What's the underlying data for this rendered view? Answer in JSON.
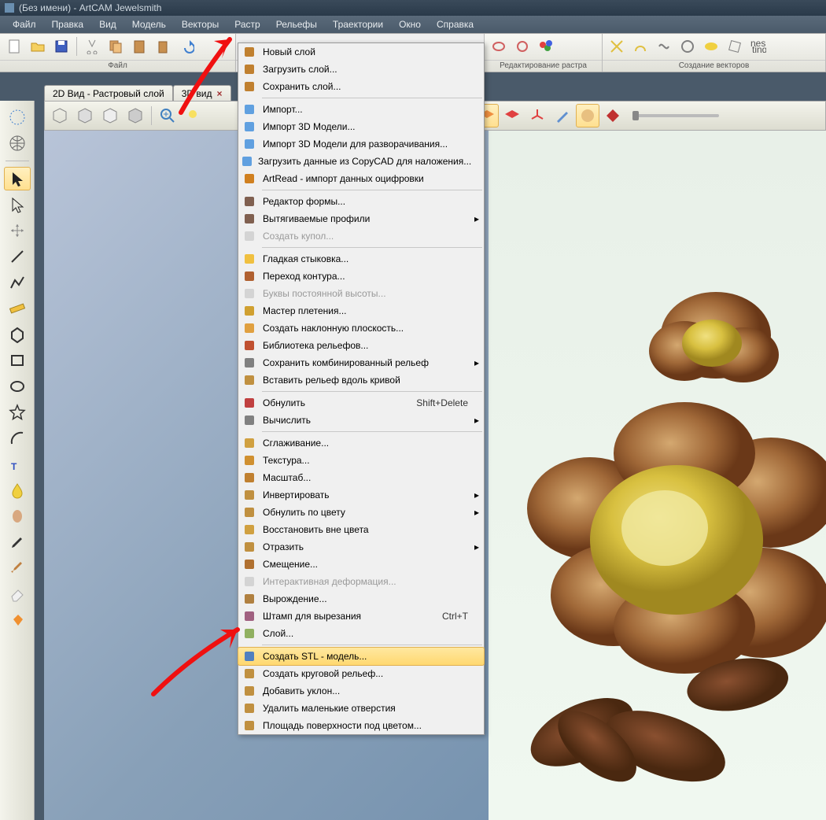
{
  "title": "(Без имени) - ArtCAM Jewelsmith",
  "menu": [
    "Файл",
    "Правка",
    "Вид",
    "Модель",
    "Векторы",
    "Растр",
    "Рельефы",
    "Траектории",
    "Окно",
    "Справка"
  ],
  "top_groups": {
    "file": "Файл",
    "raster": "Редактирование растра",
    "vector": "Создание векторов"
  },
  "tabs": {
    "t2d": "2D Вид - Растровый слой",
    "t3d": "3D вид"
  },
  "dropdown": [
    {
      "t": "Новый слой"
    },
    {
      "t": "Загрузить слой..."
    },
    {
      "t": "Сохранить слой..."
    },
    {
      "sep": true
    },
    {
      "t": "Импорт..."
    },
    {
      "t": "Импорт 3D Модели..."
    },
    {
      "t": "Импорт 3D Модели для разворачивания..."
    },
    {
      "t": "Загрузить данные из CopyCAD для наложения..."
    },
    {
      "t": "ArtRead - импорт данных оцифровки"
    },
    {
      "sep": true
    },
    {
      "t": "Редактор формы..."
    },
    {
      "t": "Вытягиваемые профили",
      "sub": true
    },
    {
      "t": "Создать купол...",
      "disabled": true
    },
    {
      "sep": true
    },
    {
      "t": "Гладкая стыковка..."
    },
    {
      "t": "Переход контура..."
    },
    {
      "t": "Буквы постоянной высоты...",
      "disabled": true
    },
    {
      "t": "Мастер плетения..."
    },
    {
      "t": "Создать наклонную плоскость..."
    },
    {
      "t": "Библиотека рельефов..."
    },
    {
      "t": "Сохранить комбинированный рельеф",
      "sub": true
    },
    {
      "t": "Вставить рельеф вдоль кривой"
    },
    {
      "sep": true
    },
    {
      "t": "Обнулить",
      "key": "Shift+Delete"
    },
    {
      "t": "Вычислить",
      "sub": true
    },
    {
      "sep": true
    },
    {
      "t": "Сглаживание..."
    },
    {
      "t": "Текстура..."
    },
    {
      "t": "Масштаб..."
    },
    {
      "t": "Инвертировать",
      "sub": true
    },
    {
      "t": "Обнулить по цвету",
      "sub": true
    },
    {
      "t": "Восстановить вне цвета"
    },
    {
      "t": "Отразить",
      "sub": true
    },
    {
      "t": "Смещение..."
    },
    {
      "t": "Интерактивная деформация...",
      "disabled": true
    },
    {
      "t": "Вырождение..."
    },
    {
      "t": "Штамп для вырезания",
      "key": "Ctrl+T"
    },
    {
      "t": "Слой..."
    },
    {
      "sep": true
    },
    {
      "t": "Создать STL - модель...",
      "highlight": true
    },
    {
      "t": "Создать круговой рельеф..."
    },
    {
      "t": "Добавить уклон..."
    },
    {
      "t": "Удалить маленькие отверстия"
    },
    {
      "t": "Площадь поверхности под цветом..."
    }
  ]
}
